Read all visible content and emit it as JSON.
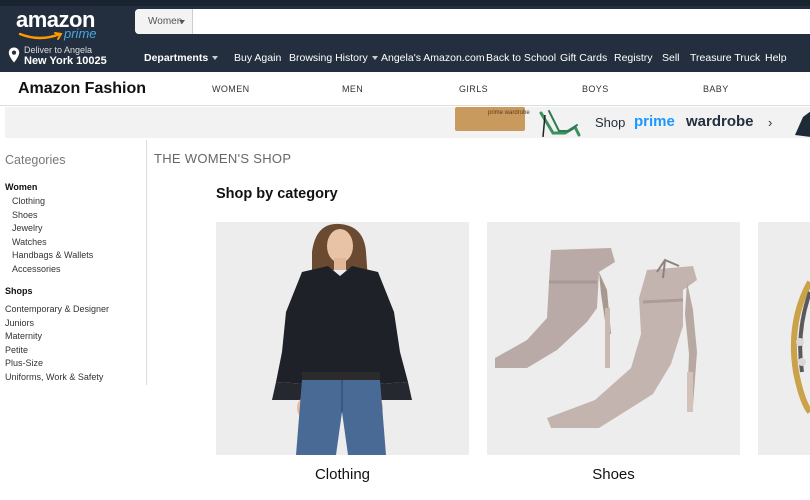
{
  "header": {
    "logo_word": "amazon",
    "logo_sub": "prime",
    "search_scope": "Women",
    "search_placeholder": "",
    "deliver_line1": "Deliver to Angela",
    "deliver_line2": "New York 10025",
    "nav": [
      {
        "label": "Departments",
        "has_caret": true
      },
      {
        "label": "Buy Again"
      },
      {
        "label": "Browsing History",
        "has_caret": true
      },
      {
        "label": "Angela's Amazon.com"
      },
      {
        "label": "Back to School"
      },
      {
        "label": "Gift Cards"
      },
      {
        "label": "Registry"
      },
      {
        "label": "Sell"
      },
      {
        "label": "Treasure Truck"
      },
      {
        "label": "Help"
      }
    ]
  },
  "subnav": {
    "title": "Amazon Fashion",
    "links": [
      "WOMEN",
      "MEN",
      "GIRLS",
      "BOYS",
      "BABY"
    ]
  },
  "banner": {
    "box_label": "prime wardrobe",
    "text_shop": "Shop",
    "text_prime": "prime",
    "text_wardrobe": "wardrobe",
    "arrow": "›"
  },
  "sidebar": {
    "heading": "Categories",
    "women_heading": "Women",
    "women_items": [
      "Clothing",
      "Shoes",
      "Jewelry",
      "Watches",
      "Handbags & Wallets",
      "Accessories"
    ],
    "shops_heading": "Shops",
    "shops_items": [
      "Contemporary & Designer",
      "Juniors",
      "Maternity",
      "Petite",
      "Plus-Size",
      "Uniforms, Work & Safety"
    ]
  },
  "main": {
    "shop_title": "THE WOMEN'S SHOP",
    "section_title": "Shop by category",
    "cards": [
      {
        "label": "Clothing",
        "icon": "blouse-image"
      },
      {
        "label": "Shoes",
        "icon": "heels-image"
      },
      {
        "label": "",
        "icon": "jewelry-image"
      }
    ]
  },
  "colors": {
    "header_bg": "#232f3e",
    "prime_blue": "#1a98ff",
    "card_bg": "#eeeded"
  }
}
